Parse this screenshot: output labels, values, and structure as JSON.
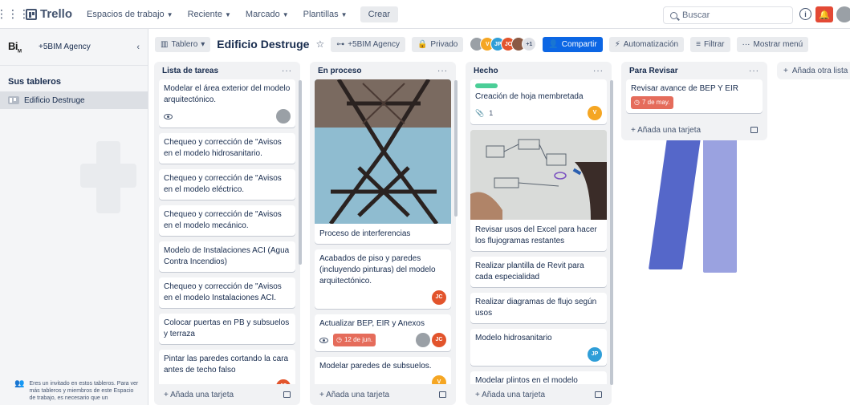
{
  "topnav": {
    "brand": "Trello",
    "menus": [
      "Espacios de trabajo",
      "Reciente",
      "Marcado",
      "Plantillas"
    ],
    "create_label": "Crear",
    "search_placeholder": "Buscar"
  },
  "sidebar": {
    "workspace_logo": "Bi",
    "workspace_logo_sub": "M",
    "workspace_name": "+5BIM Agency",
    "section_title": "Sus tableros",
    "boards": [
      {
        "name": "Edificio Destruge"
      }
    ],
    "guest_notice": "Eres un invitado en estos tableros. Para ver más tableros y miembros de este Espacio de trabajo, es necesario que un"
  },
  "board_header": {
    "view_label": "Tablero",
    "title": "Edificio Destruge",
    "workspace_label": "+5BIM Agency",
    "visibility_label": "Privado",
    "member_initials": [
      "",
      "V",
      "JP",
      "JC",
      ""
    ],
    "member_colors": [
      "#9aa0a6",
      "#f5a623",
      "#2f9ed8",
      "#e2542c",
      "#8a5a44"
    ],
    "extra_members": "+1",
    "share_label": "Compartir",
    "automation_label": "Automatización",
    "filter_label": "Filtrar",
    "show_menu_label": "Mostrar menú"
  },
  "lists": [
    {
      "title": "Lista de tareas",
      "cards": [
        {
          "text": "Modelar el área exterior del modelo arquitectónico."
        },
        {
          "text": "Chequeo y corrección de \"Avisos en el modelo hidrosanitario."
        },
        {
          "text": "Chequeo y corrección de \"Avisos en el modelo eléctrico."
        },
        {
          "text": "Chequeo y corrección de \"Avisos en el modelo mecánico."
        },
        {
          "text": "Modelo de Instalaciones ACI (Agua Contra Incendios)"
        },
        {
          "text": "Chequeo y corrección de \"Avisos en el modelo Instalaciones ACI."
        },
        {
          "text": "Colocar puertas en PB y subsuelos y terraza"
        },
        {
          "text": "Pintar las paredes cortando la cara antes de techo falso",
          "avatar": "JC"
        }
      ]
    },
    {
      "title": "En proceso",
      "cards": [
        {
          "text": "Proceso de interferencias"
        },
        {
          "text": "Acabados de piso y paredes (incluyendo pinturas) del modelo arquitectónico.",
          "avatar": "JC"
        },
        {
          "text": "Actualizar BEP, EIR y Anexos",
          "due": "12 de jun.",
          "avatar": "JC"
        },
        {
          "text": "Modelar paredes de subsuelos.",
          "avatar": "V"
        }
      ]
    },
    {
      "title": "Hecho",
      "cards": [
        {
          "text": "Creación de hoja membretada",
          "attachments": "1",
          "avatar": "V"
        },
        {
          "text": "Revisar usos del Excel para hacer los flujogramas restantes"
        },
        {
          "text": "Realizar plantilla de Revit para cada especialidad"
        },
        {
          "text": "Realizar diagramas de flujo según usos"
        },
        {
          "text": "Modelo hidrosanitario",
          "avatar": "JP"
        },
        {
          "text": "Modelar plintos en el modelo estructural."
        }
      ]
    },
    {
      "title": "Para Revisar",
      "cards": [
        {
          "text": "Revisar avance de BEP Y EIR",
          "due": "7 de may."
        }
      ]
    }
  ],
  "add_card_label": "Añada una tarjeta",
  "add_list_label": "Añada otra lista",
  "colors": {
    "accent": "#0c66e4",
    "due_red": "#e56c5b",
    "jc": "#e2542c",
    "v": "#f5a623",
    "jp": "#2f9ed8",
    "label_green": "#4bce97"
  }
}
